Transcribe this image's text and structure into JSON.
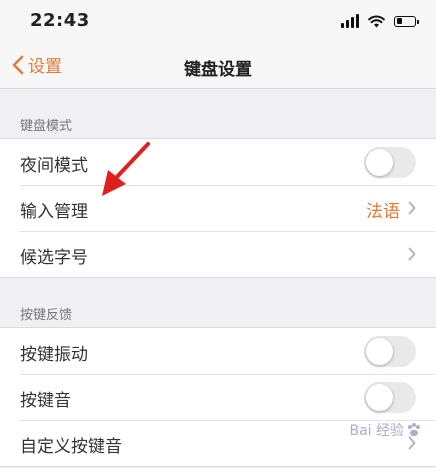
{
  "status_bar": {
    "time": "22:43",
    "battery_level": 0.3
  },
  "nav": {
    "back_label": "设置",
    "title": "键盘设置"
  },
  "sections": [
    {
      "header": "键盘模式",
      "rows": [
        {
          "label": "夜间模式",
          "type": "toggle",
          "on": false
        },
        {
          "label": "输入管理",
          "type": "value",
          "value": "法语"
        },
        {
          "label": "候选字号",
          "type": "chevron"
        }
      ]
    },
    {
      "header": "按键反馈",
      "rows": [
        {
          "label": "按键振动",
          "type": "toggle",
          "on": false
        },
        {
          "label": "按键音",
          "type": "toggle",
          "on": false
        },
        {
          "label": "自定义按键音",
          "type": "chevron"
        }
      ]
    }
  ],
  "colors": {
    "accent": "#e07b39",
    "annotation_arrow": "#e02020"
  },
  "watermark_text": "Bai 经验"
}
